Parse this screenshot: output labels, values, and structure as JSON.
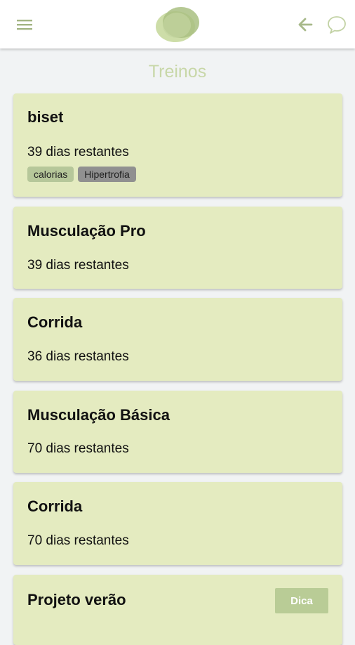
{
  "header": {
    "menu_icon": "hamburger-menu-icon",
    "logo": "app-logo",
    "back_icon": "arrow-left-icon",
    "chat_icon": "chat-bubble-icon",
    "accent_color": "#b9cc96"
  },
  "page": {
    "title": "Treinos"
  },
  "workouts": [
    {
      "name": "biset",
      "remaining": "39 dias restantes",
      "tags": [
        "calorias",
        "Hipertrofia"
      ]
    },
    {
      "name": "Musculação Pro",
      "remaining": "39 dias restantes"
    },
    {
      "name": "Corrida",
      "remaining": "36 dias restantes"
    },
    {
      "name": "Musculação Básica",
      "remaining": "70 dias restantes"
    },
    {
      "name": "Corrida",
      "remaining": "70 dias restantes"
    },
    {
      "name": "Projeto verão",
      "button": "Dica"
    }
  ],
  "colors": {
    "card_background": "#e4ebc0",
    "tag_calorias": "#b6c79a",
    "tag_hipertrofia": "#909090",
    "title_color": "#c8d7a8"
  }
}
